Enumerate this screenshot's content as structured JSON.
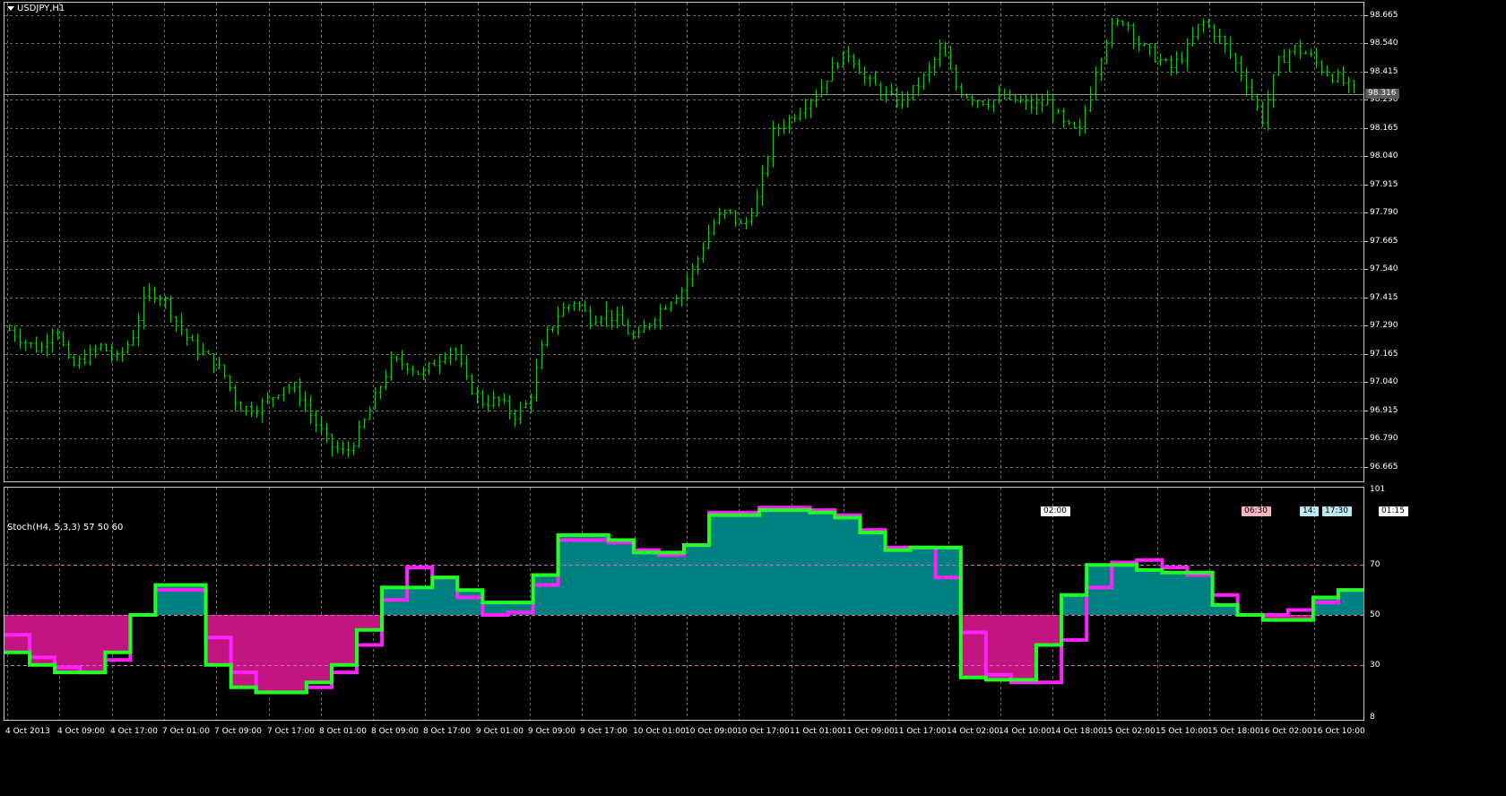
{
  "symbol_title": "USDJPY,H1",
  "indicator_title": "Stoch(H4, 5,3,3) 57 50 60",
  "current_price": "98.316",
  "price_axis": [
    "98.665",
    "98.540",
    "98.415",
    "98.290",
    "98.165",
    "98.040",
    "97.915",
    "97.790",
    "97.665",
    "97.540",
    "97.415",
    "97.290",
    "97.165",
    "97.040",
    "96.915",
    "96.790",
    "96.665"
  ],
  "stoch_axis": [
    "101",
    "70",
    "50",
    "30",
    "8"
  ],
  "time_axis": [
    "4 Oct 2013",
    "4 Oct 09:00",
    "4 Oct 17:00",
    "7 Oct 01:00",
    "7 Oct 09:00",
    "7 Oct 17:00",
    "8 Oct 01:00",
    "8 Oct 09:00",
    "8 Oct 17:00",
    "9 Oct 01:00",
    "9 Oct 09:00",
    "9 Oct 17:00",
    "10 Oct 01:00",
    "10 Oct 09:00",
    "10 Oct 17:00",
    "11 Oct 01:00",
    "11 Oct 09:00",
    "11 Oct 17:00",
    "14 Oct 02:00",
    "14 Oct 10:00",
    "14 Oct 18:00",
    "15 Oct 02:00",
    "15 Oct 10:00",
    "15 Oct 18:00",
    "16 Oct 02:00",
    "16 Oct 10:00"
  ],
  "event_tags": [
    {
      "text": "02:00",
      "color": "#ffffff"
    },
    {
      "text": "06:30",
      "color": "#f2b6bf"
    },
    {
      "text": "14:",
      "color": "#bfe8f2"
    },
    {
      "text": "17:30",
      "color": "#bfe8f2"
    },
    {
      "text": "01:15",
      "color": "#ffffff"
    }
  ],
  "colors": {
    "background": "#000000",
    "grid": "#6b6b6b",
    "bars": "#1ebc1e",
    "stoch_main": "#22ff22",
    "stoch_signal": "#ff22ff",
    "fill_up": "#008080",
    "fill_down": "#c3157f",
    "level_lines": "#d070d0",
    "price_line": "#8a8a8a"
  },
  "chart_data": [
    {
      "type": "ohlc",
      "title": "USDJPY,H1",
      "ylim": [
        96.6,
        98.72
      ],
      "current_price": 98.316,
      "close_path": [
        97.27,
        97.22,
        97.18,
        97.3,
        97.1,
        97.15,
        97.2,
        97.14,
        97.23,
        97.44,
        97.42,
        97.3,
        97.2,
        97.15,
        97.08,
        96.93,
        96.92,
        96.96,
        97.03,
        96.98,
        96.86,
        96.76,
        96.72,
        96.83,
        96.98,
        97.13,
        97.12,
        97.07,
        97.14,
        97.2,
        97.03,
        96.95,
        96.96,
        96.89,
        96.95,
        97.23,
        97.35,
        97.4,
        97.32,
        97.35,
        97.3,
        97.22,
        97.32,
        97.39,
        97.45,
        97.58,
        97.74,
        97.8,
        97.72,
        97.86,
        98.15,
        98.2,
        98.27,
        98.33,
        98.45,
        98.5,
        98.38,
        98.33,
        98.28,
        98.32,
        98.4,
        98.52,
        98.34,
        98.3,
        98.28,
        98.3,
        98.28,
        98.26,
        98.28,
        98.18,
        98.14,
        98.4,
        98.6,
        98.65,
        98.53,
        98.48,
        98.43,
        98.5,
        98.64,
        98.58,
        98.48,
        98.36,
        98.2,
        98.45,
        98.52,
        98.49,
        98.42,
        98.38,
        98.33
      ]
    },
    {
      "type": "line",
      "title": "Stoch(H4, 5,3,3) 57 50 60",
      "ylim": [
        8,
        101
      ],
      "levels": [
        70,
        50,
        30
      ],
      "step": 1,
      "series": [
        {
          "name": "main",
          "values": [
            35,
            30,
            27,
            27,
            35,
            50,
            62,
            62,
            30,
            21,
            19,
            19,
            23,
            30,
            44,
            61,
            61,
            65,
            60,
            55,
            55,
            66,
            82,
            82,
            80,
            75,
            75,
            78,
            90,
            90,
            92,
            92,
            91,
            89,
            83,
            76,
            77,
            77,
            25,
            24,
            24,
            38,
            58,
            70,
            70,
            68,
            67,
            67,
            54,
            50,
            48,
            48,
            57,
            60
          ]
        },
        {
          "name": "signal",
          "values": [
            42,
            33,
            29,
            27,
            32,
            50,
            60,
            60,
            41,
            27,
            19,
            19,
            21,
            27,
            38,
            56,
            69,
            65,
            57,
            50,
            51,
            62,
            80,
            80,
            79,
            76,
            74,
            78,
            91,
            91,
            93,
            93,
            92,
            90,
            84,
            77,
            77,
            65,
            43,
            26,
            23,
            23,
            40,
            61,
            71,
            72,
            69,
            66,
            58,
            50,
            50,
            52,
            55,
            60
          ]
        }
      ]
    }
  ]
}
